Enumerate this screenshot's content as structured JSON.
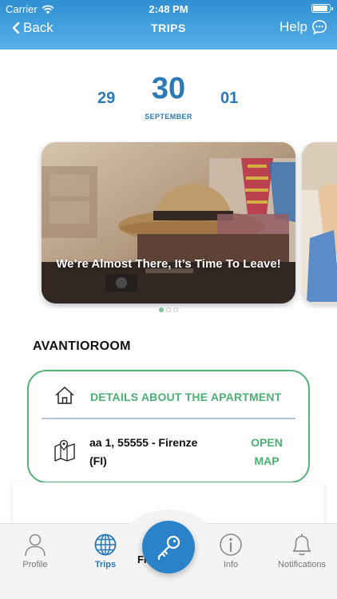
{
  "status_bar": {
    "carrier": "Carrier",
    "time": "2:48 PM"
  },
  "nav": {
    "back_label": "Back",
    "title": "TRIPS",
    "help_label": "Help"
  },
  "date_selector": {
    "prev_day": "29",
    "current_day": "30",
    "next_day": "01",
    "month": "SEPTEMBER"
  },
  "carousel": {
    "slides": [
      {
        "caption": "We’re Almost There, It’s Time To Leave!"
      },
      {
        "caption": ""
      }
    ],
    "active_index": 0,
    "dot_count": 3
  },
  "property": {
    "name": "AVANTIOROOM",
    "details_label": "DETAILS ABOUT THE APARTMENT",
    "address_line1": "aa 1, 55555 - Firenze",
    "address_line2": "(FI)",
    "open_map_line1": "OPEN",
    "open_map_line2": "MAP"
  },
  "lower_peek_text": "FI",
  "tabbar": {
    "profile": "Profile",
    "trips": "Trips",
    "info": "Info",
    "notifications": "Notifications",
    "active": "trips"
  },
  "colors": {
    "header_start": "#2f8fd3",
    "header_end": "#57b0e8",
    "accent_blue": "#2a7ab8",
    "accent_green": "#4caf74",
    "card_border": "#5ab27b"
  }
}
